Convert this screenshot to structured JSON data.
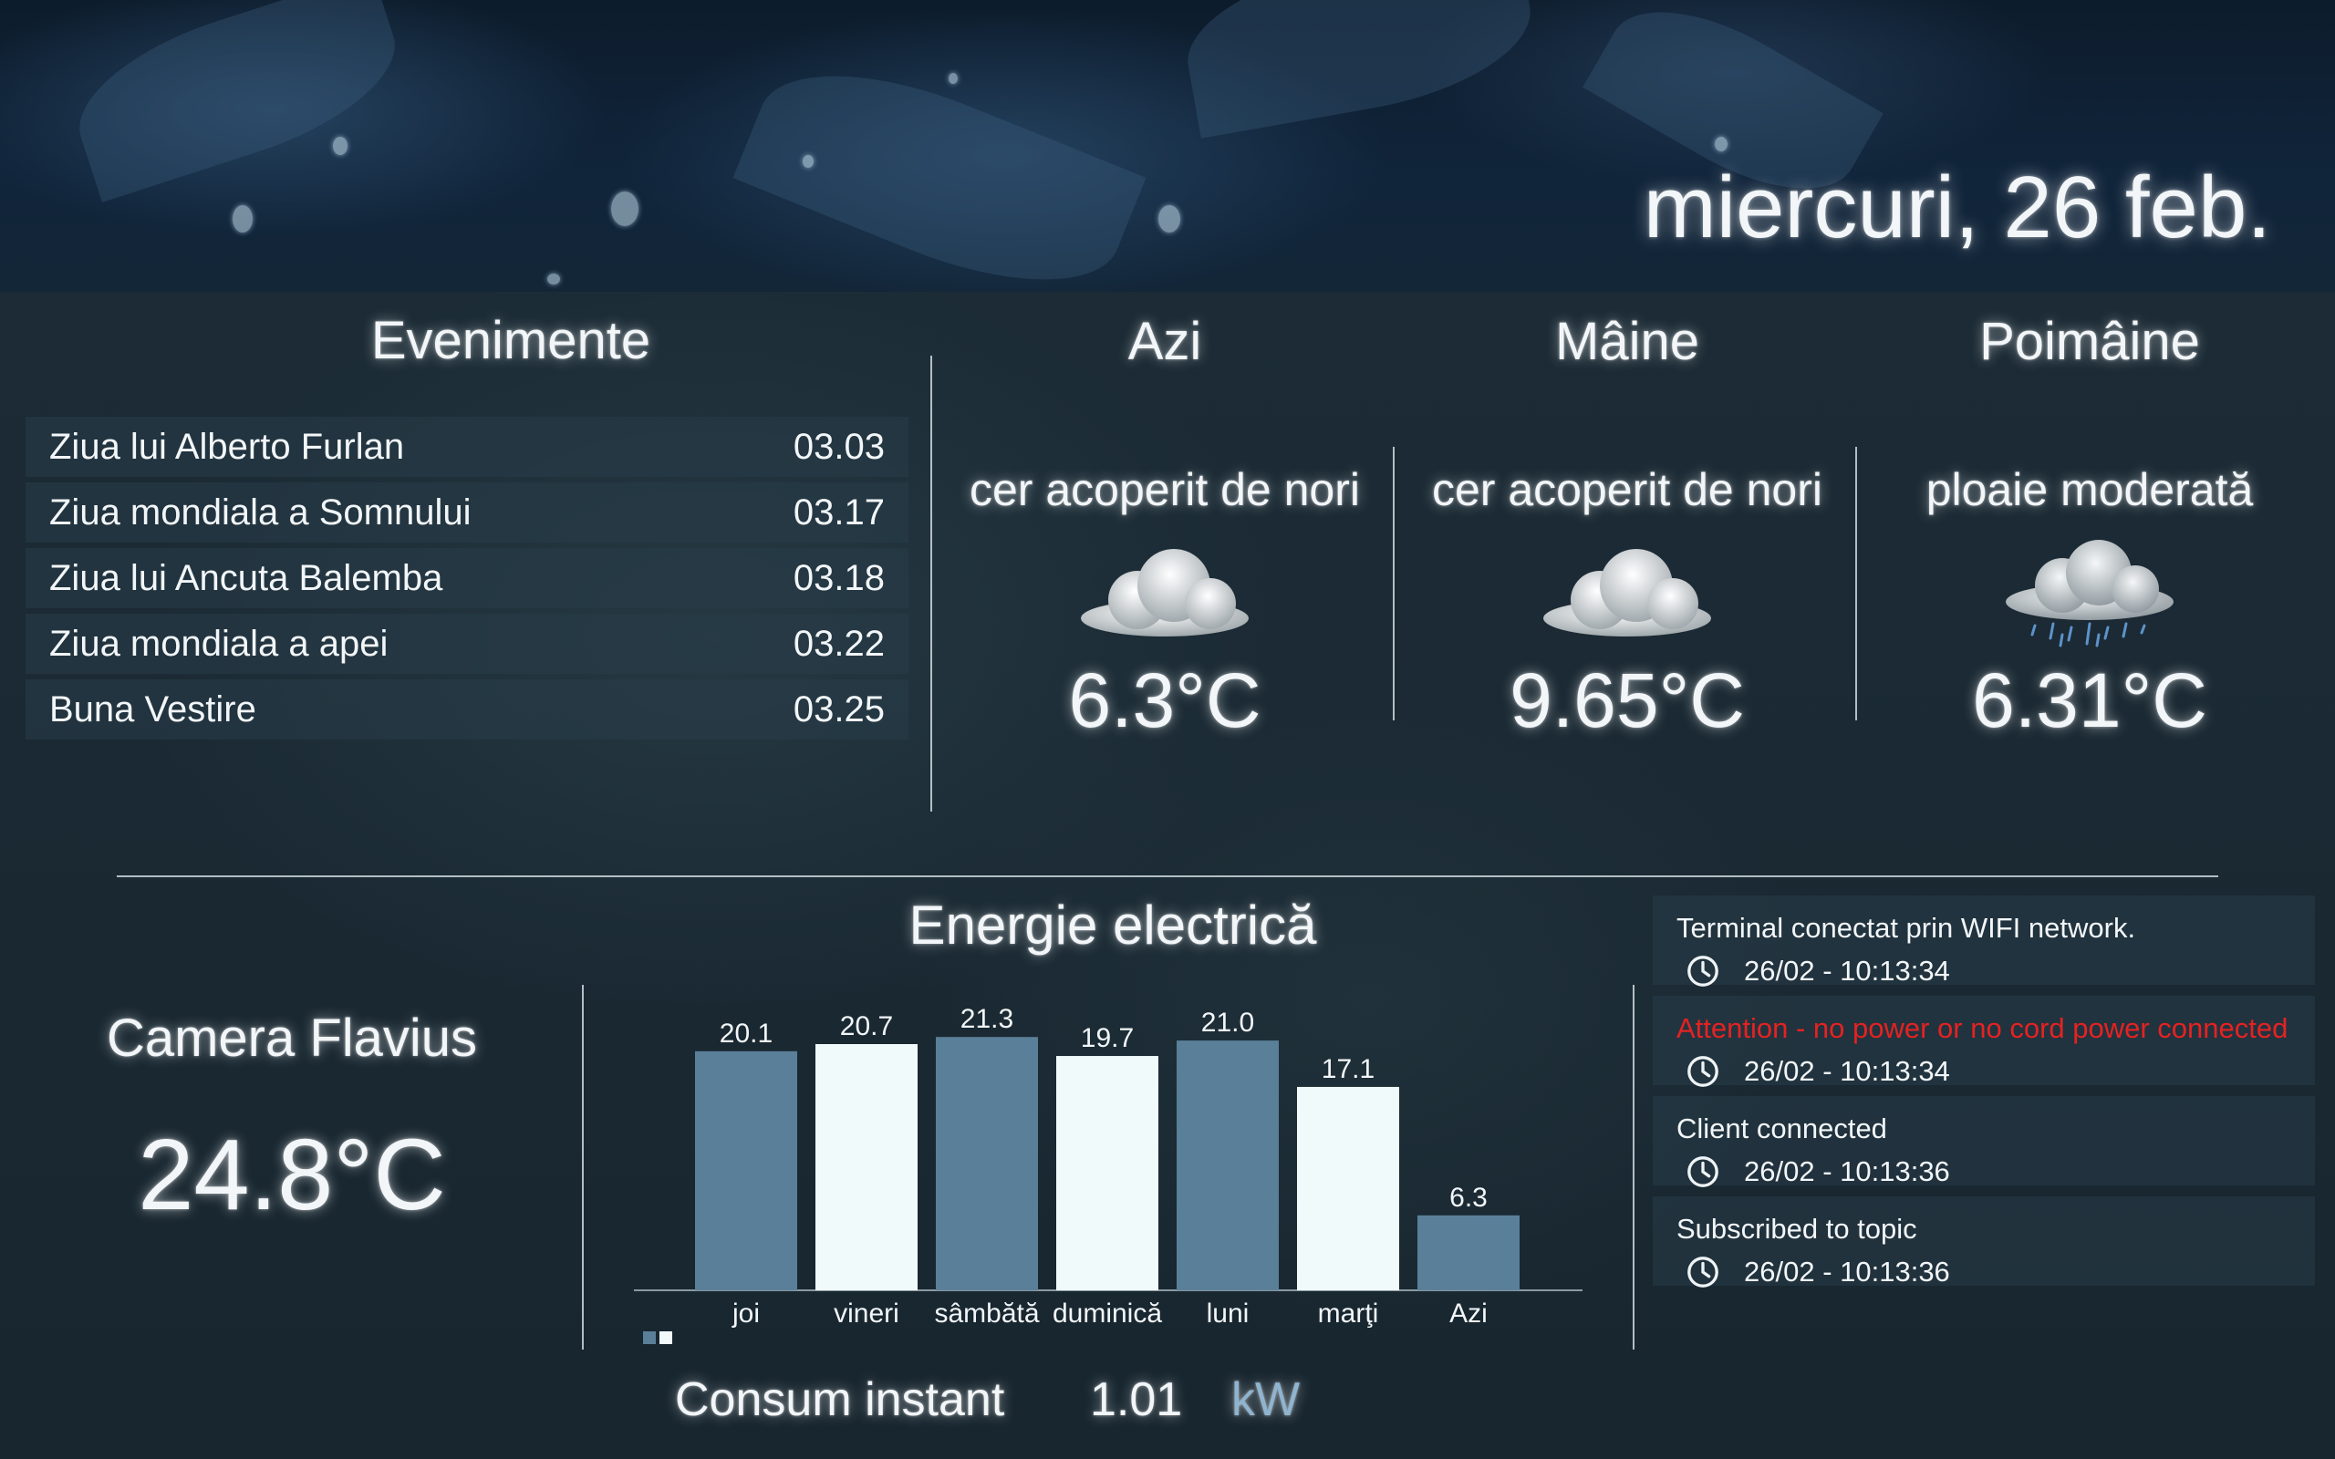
{
  "header": {
    "date": "miercuri, 26 feb."
  },
  "events": {
    "title": "Evenimente",
    "items": [
      {
        "name": "Ziua lui Alberto Furlan",
        "date": "03.03"
      },
      {
        "name": "Ziua mondiala a Somnului",
        "date": "03.17"
      },
      {
        "name": "Ziua lui Ancuta Balemba",
        "date": "03.18"
      },
      {
        "name": "Ziua mondiala a apei",
        "date": "03.22"
      },
      {
        "name": "Buna Vestire",
        "date": "03.25"
      }
    ]
  },
  "forecast": [
    {
      "day": "Azi",
      "description": "cer acoperit de nori",
      "icon": "cloud-icon",
      "temperature": "6.3°C"
    },
    {
      "day": "Mâine",
      "description": "cer acoperit de nori",
      "icon": "cloud-icon",
      "temperature": "9.65°C"
    },
    {
      "day": "Poimâine",
      "description": "ploaie moderată",
      "icon": "rain-cloud-icon",
      "temperature": "6.31°C"
    }
  ],
  "room": {
    "name": "Camera Flavius",
    "temperature": "24.8°C"
  },
  "energy": {
    "title": "Energie electrică",
    "consum_label": "Consum instant",
    "consum_value": "1.01",
    "consum_unit": "kW"
  },
  "chart_data": {
    "type": "bar",
    "title": "Energie electrică",
    "categories": [
      "joi",
      "vineri",
      "sâmbătă",
      "duminică",
      "luni",
      "marţi",
      "Azi"
    ],
    "values": [
      20.1,
      20.7,
      21.3,
      19.7,
      21.0,
      17.1,
      6.3
    ],
    "colors": [
      "#5a7f99",
      "#f1fafb",
      "#5a7f99",
      "#f1fafb",
      "#5a7f99",
      "#f1fafb",
      "#5a7f99"
    ],
    "ylim": [
      0,
      23
    ],
    "xlabel": "",
    "ylabel": "",
    "grid": false,
    "legend": "bottom-left"
  },
  "log": [
    {
      "message": "Terminal conectat prin WIFI network.",
      "time": "26/02 - 10:13:34",
      "alert": false
    },
    {
      "message": "Attention - no power or no cord power connected",
      "time": "26/02 - 10:13:34",
      "alert": true
    },
    {
      "message": "Client connected",
      "time": "26/02 - 10:13:36",
      "alert": false
    },
    {
      "message": "Subscribed to topic",
      "time": "26/02 - 10:13:36",
      "alert": false
    }
  ],
  "colors": {
    "accent": "#5a7f99",
    "light_bar": "#f1fafb",
    "alert": "#e52222",
    "unit": "#8fb4d0"
  }
}
